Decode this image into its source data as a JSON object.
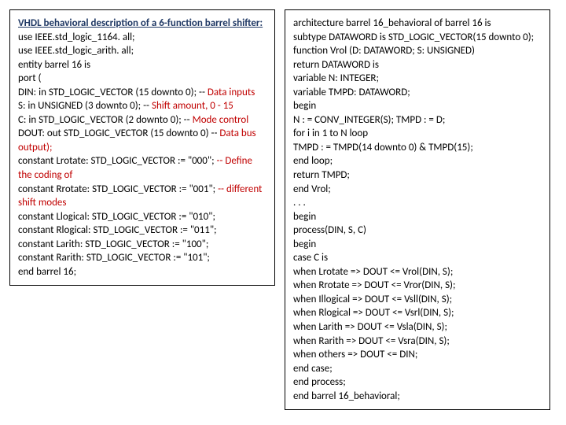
{
  "left": {
    "title": "VHDL behavioral description of a 6-function barrel shifter:",
    "lines": [
      {
        "t": "use IEEE.std_logic_1164. all;"
      },
      {
        "t": "use IEEE.std_logic_arith. all;"
      },
      {
        "t": "entity barrel 16 is"
      },
      {
        "t": "port ("
      },
      {
        "t": "DIN: in STD_LOGIC_VECTOR (15 downto 0); -- ",
        "red": "Data inputs"
      },
      {
        "t": "S: in UNSIGNED (3 downto 0); -- ",
        "red": "Shift amount, 0 - 15"
      },
      {
        "t": "C: in STD_LOGIC_VECTOR (2 downto 0); -- ",
        "red": "Mode control"
      },
      {
        "t": "DOUT: out STD_LOGIC_VECTOR (15 downto 0) -- ",
        "red": "Data bus output);"
      },
      {
        "t": "constant Lrotate: STD_LOGIC_VECTOR := \"000\"; ",
        "red": "-- Define the coding of"
      },
      {
        "t": "constant Rrotate: STD_LOGIC_VECTOR := \"001\"; ",
        "red": "-- different shift modes"
      },
      {
        "t": "constant Llogical: STD_LOGIC_VECTOR := \"010\";"
      },
      {
        "t": "constant Rlogical: STD_LOGIC_VECTOR := \"011\";"
      },
      {
        "t": "constant Larith: STD_LOGIC_VECTOR := \"100\";"
      },
      {
        "t": "constant Rarith: STD_LOGIC_VECTOR := \"101\";"
      },
      {
        "t": "end barrel 16;"
      }
    ]
  },
  "right": {
    "lines": [
      "architecture barrel 16_behavioral of barrel 16 is",
      "subtype DATAWORD is STD_LOGIC_VECTOR(15 downto 0);",
      "function Vrol (D: DATAWORD; S: UNSIGNED)",
      "return DATAWORD is",
      "variable N: INTEGER;",
      "variable TMPD: DATAWORD;",
      "begin",
      "N : = CONV_INTEGER(S); TMPD : = D;",
      "for i in 1 to N loop",
      "TMPD : = TMPD(14 downto 0) & TMPD(15);",
      "end loop;",
      "return TMPD;",
      "end Vrol;",
      ". . .",
      "begin",
      "process(DIN, S, C)",
      "begin",
      "case C is",
      "when Lrotate => DOUT <= Vrol(DIN, S);",
      "when Rrotate => DOUT <= Vror(DIN, S);",
      "when Illogical => DOUT <= Vsll(DIN, S);",
      "when Rlogical => DOUT <= Vsrl(DIN, S);",
      "when Larith => DOUT <= Vsla(DIN, S);",
      "when Rarith => DOUT <= Vsra(DIN, S);",
      "when others => DOUT <= DIN;",
      "end case;",
      "end process;",
      "end barrel 16_behavioral;"
    ]
  }
}
